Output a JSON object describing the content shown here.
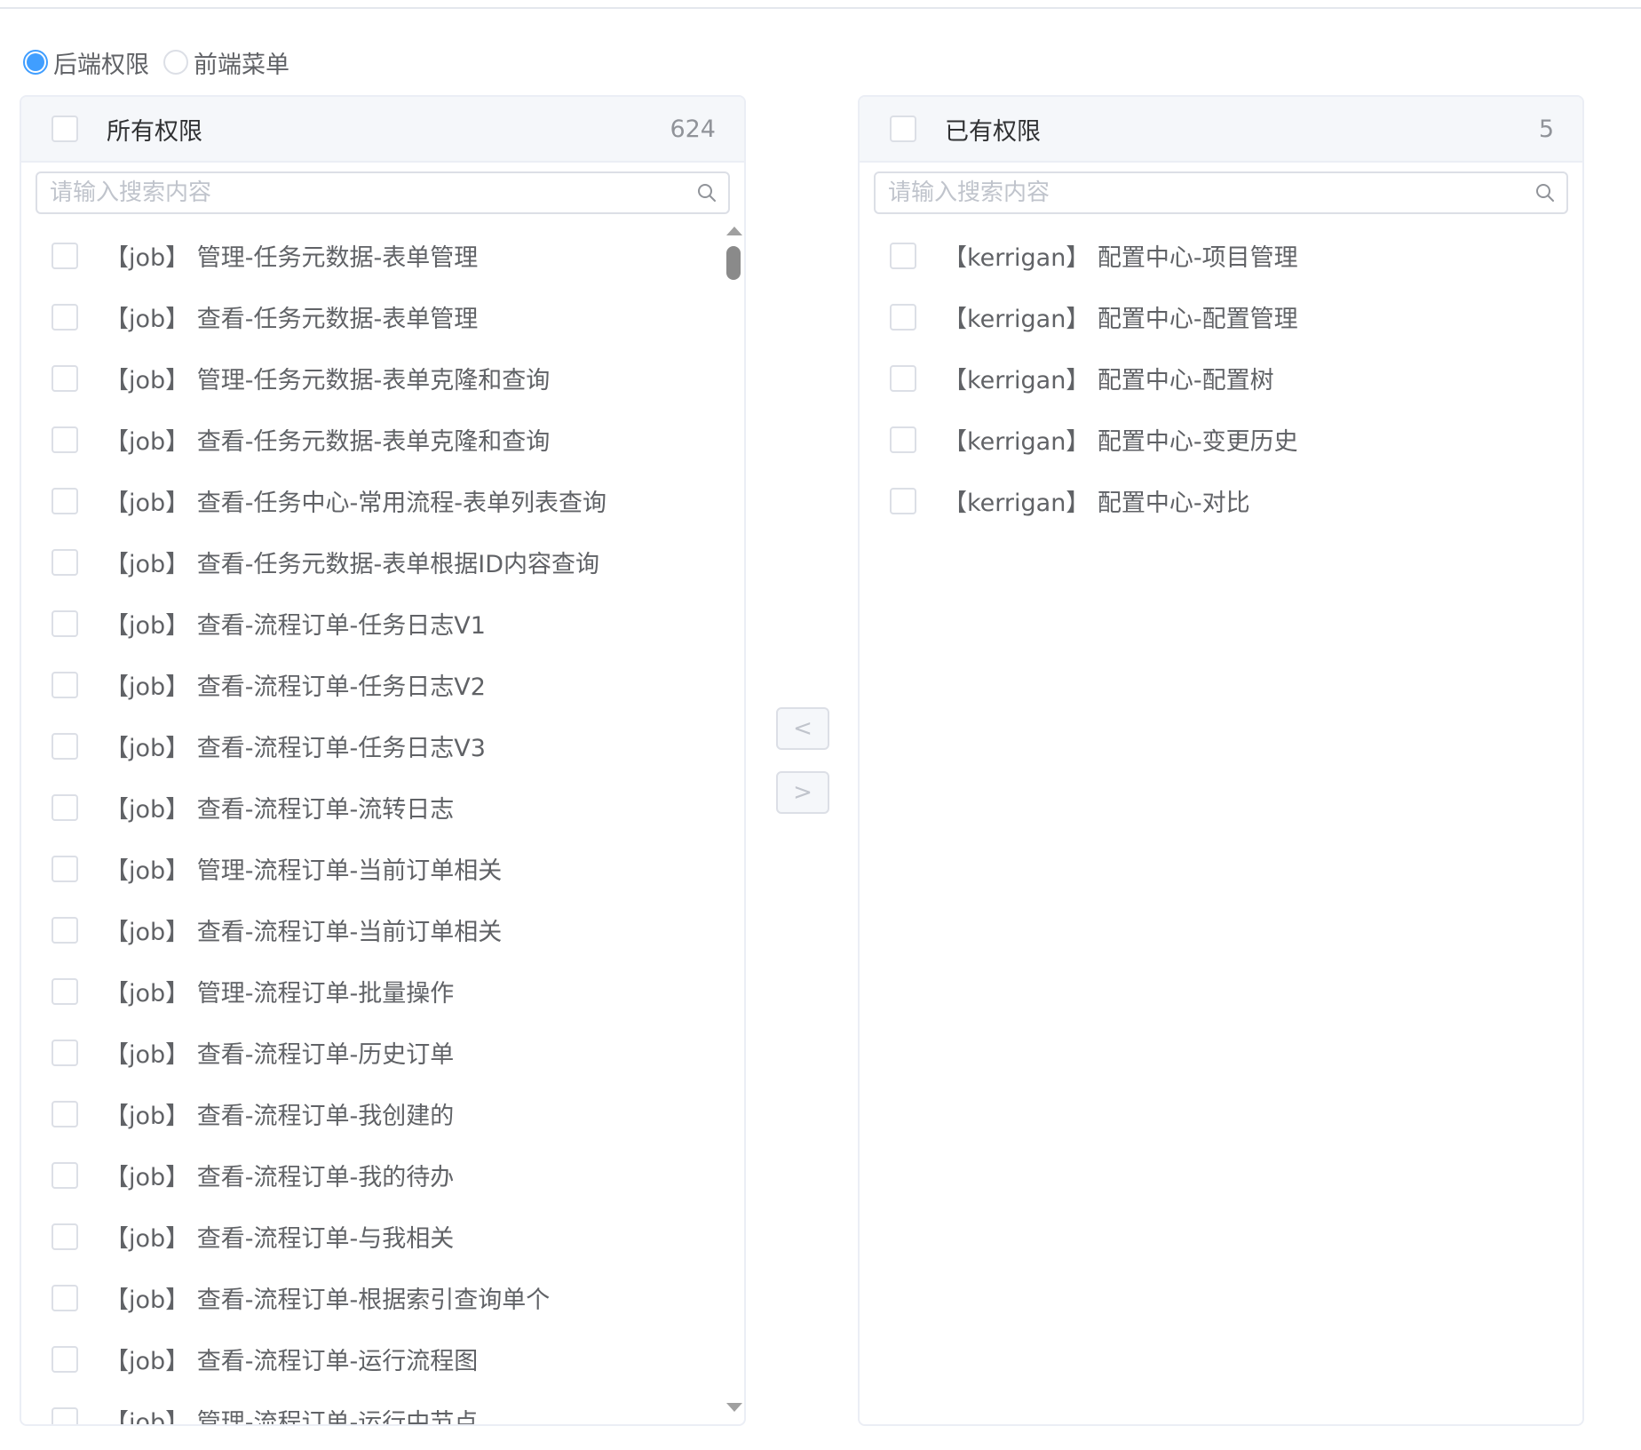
{
  "mode_tabs": {
    "options": [
      {
        "label": "后端权限",
        "checked": true
      },
      {
        "label": "前端菜单",
        "checked": false
      }
    ]
  },
  "left_panel": {
    "title": "所有权限",
    "count": "624",
    "search_placeholder": "请输入搜索内容",
    "items": [
      "【job】 管理-任务元数据-表单管理",
      "【job】 查看-任务元数据-表单管理",
      "【job】 管理-任务元数据-表单克隆和查询",
      "【job】 查看-任务元数据-表单克隆和查询",
      "【job】 查看-任务中心-常用流程-表单列表查询",
      "【job】 查看-任务元数据-表单根据ID内容查询",
      "【job】 查看-流程订单-任务日志V1",
      "【job】 查看-流程订单-任务日志V2",
      "【job】 查看-流程订单-任务日志V3",
      "【job】 查看-流程订单-流转日志",
      "【job】 管理-流程订单-当前订单相关",
      "【job】 查看-流程订单-当前订单相关",
      "【job】 管理-流程订单-批量操作",
      "【job】 查看-流程订单-历史订单",
      "【job】 查看-流程订单-我创建的",
      "【job】 查看-流程订单-我的待办",
      "【job】 查看-流程订单-与我相关",
      "【job】 查看-流程订单-根据索引查询单个",
      "【job】 查看-流程订单-运行流程图",
      "【job】 管理-流程订单-运行中节点"
    ]
  },
  "right_panel": {
    "title": "已有权限",
    "count": "5",
    "search_placeholder": "请输入搜索内容",
    "items": [
      "【kerrigan】 配置中心-项目管理",
      "【kerrigan】 配置中心-配置管理",
      "【kerrigan】 配置中心-配置树",
      "【kerrigan】 配置中心-变更历史",
      "【kerrigan】 配置中心-对比"
    ]
  },
  "transfer": {
    "to_left_label": "<",
    "to_right_label": ">"
  },
  "colors": {
    "accent": "#409eff",
    "border": "#dcdfe6",
    "header_bg": "#f5f7fa",
    "text": "#606266"
  },
  "icons": {
    "search": "search-icon",
    "radio": "radio-icon"
  }
}
